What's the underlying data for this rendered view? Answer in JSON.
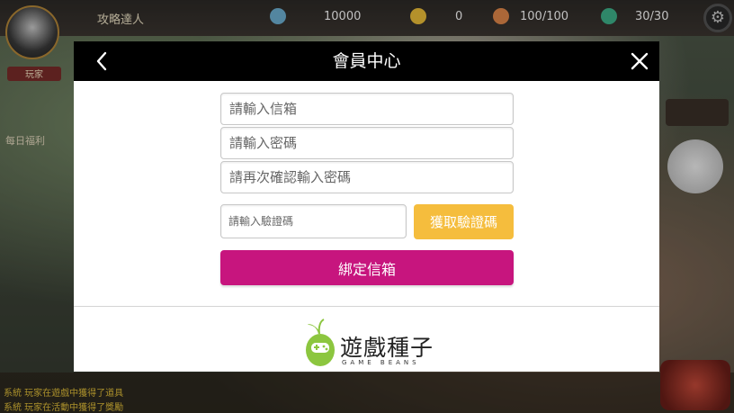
{
  "game": {
    "player_name": "攻略達人",
    "gold": "10000",
    "gems": "0",
    "stamina": "100/100",
    "energy": "30/30",
    "profile_button": "玩家",
    "daily_label": "每日福利",
    "chat_lines": [
      "系統 玩家在遊戲中獲得了道具",
      "系統 玩家在活動中獲得了獎勵"
    ]
  },
  "modal": {
    "title": "會員中心",
    "email_placeholder": "請輸入信箱",
    "password_placeholder": "請輸入密碼",
    "confirm_placeholder": "請再次確認輸入密碼",
    "code_placeholder": "請輸入驗證碼",
    "get_code_label": "獲取驗證碼",
    "bind_label": "綁定信箱"
  },
  "brand": {
    "name": "遊戲種子",
    "subtitle": "GAME BEANS"
  },
  "colors": {
    "header": "#000000",
    "get_code": "#f5bd3d",
    "bind": "#c7157e",
    "logo_green": "#8cc63f"
  },
  "icons": [
    "back-arrow-icon",
    "close-icon",
    "settings-gear-icon",
    "game-beans-logo-icon"
  ]
}
